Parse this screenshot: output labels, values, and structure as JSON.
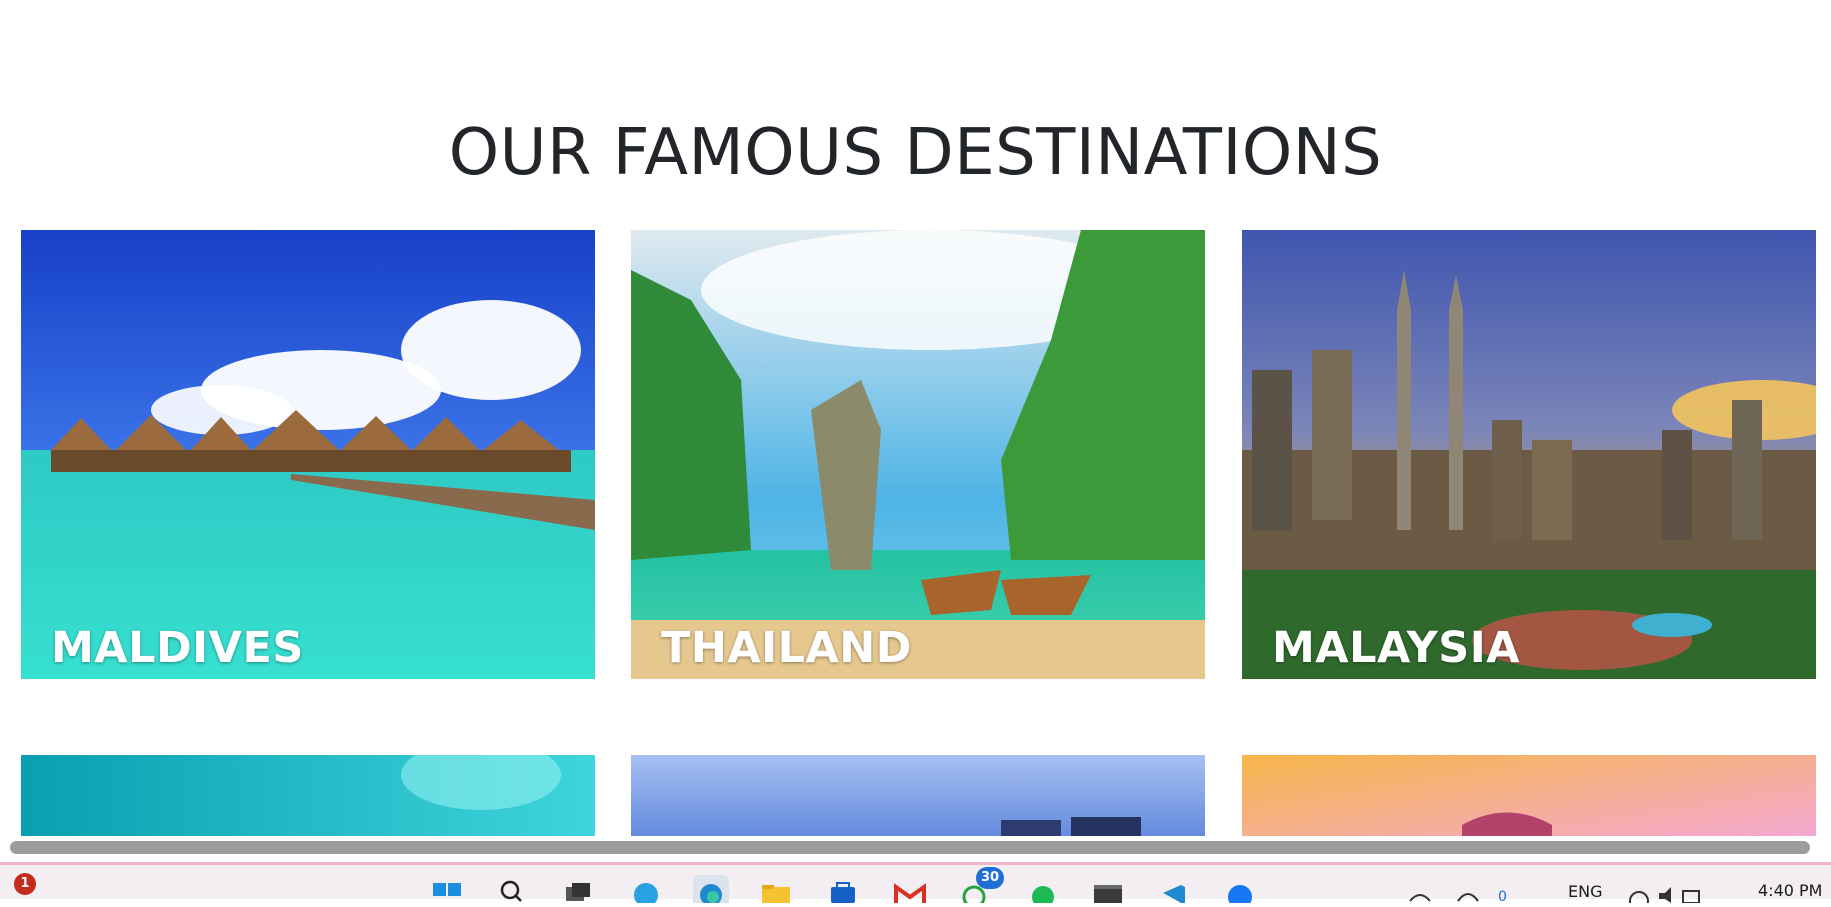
{
  "section": {
    "title": "OUR FAMOUS DESTINATIONS"
  },
  "destinations": [
    {
      "name": "MALDIVES"
    },
    {
      "name": "THAILAND"
    },
    {
      "name": "MALAYSIA"
    }
  ],
  "taskbar": {
    "widgets_badge": "1",
    "whatsapp_badge": "30",
    "language": "ENG",
    "time": "4:40 PM",
    "icons": [
      "start-icon",
      "search-icon",
      "task-view-icon",
      "telegram-icon",
      "edge-icon",
      "file-explorer-icon",
      "store-icon",
      "gmail-icon",
      "whatsapp-icon",
      "spotify-icon",
      "terminal-icon",
      "vscode-icon",
      "messenger-icon"
    ]
  }
}
